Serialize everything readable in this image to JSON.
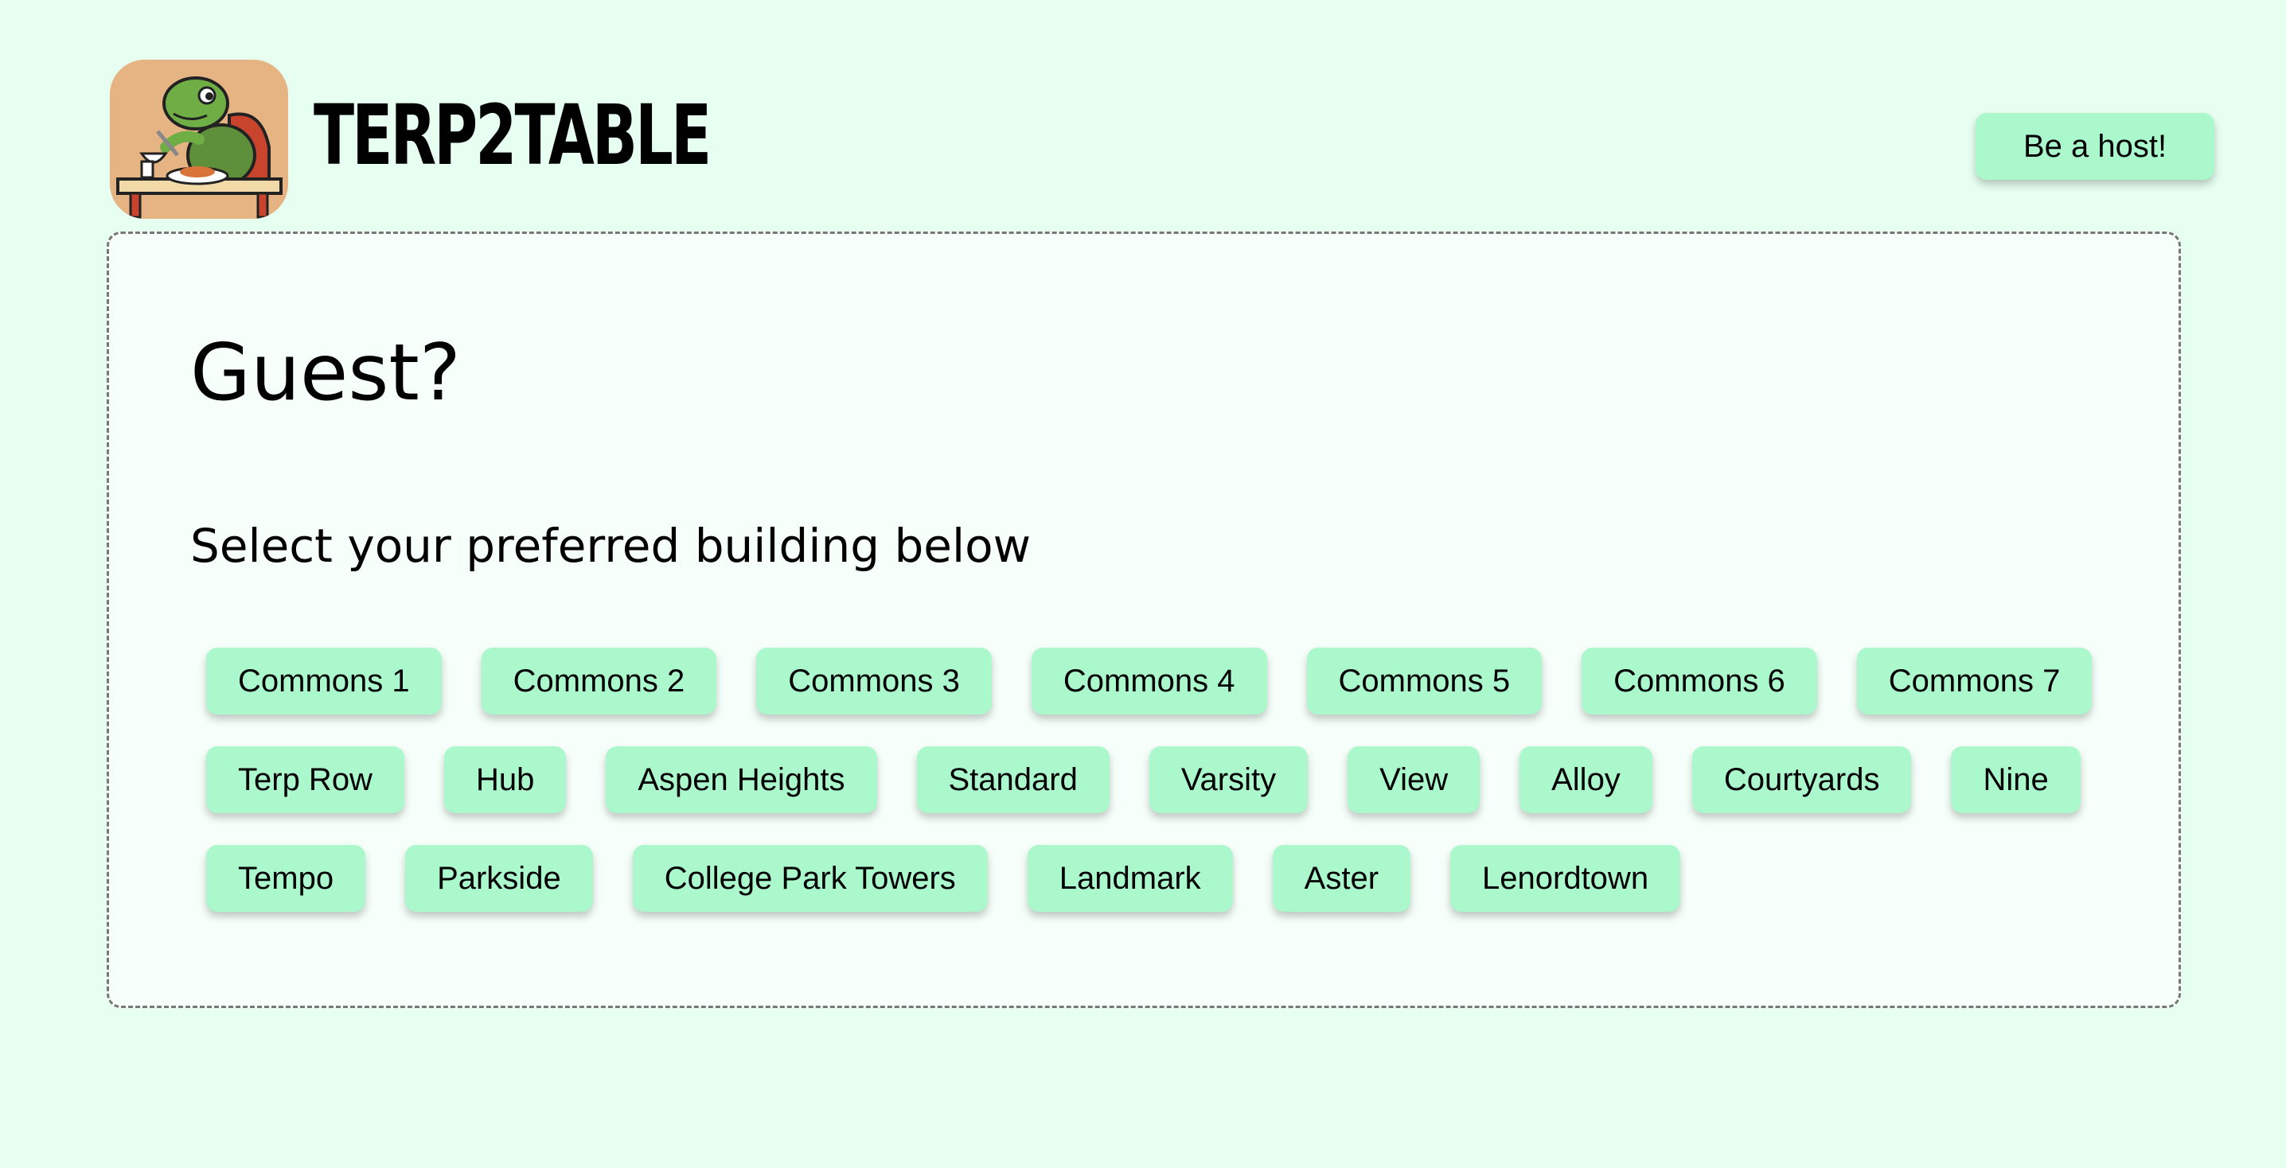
{
  "header": {
    "brand": "TERP2TABLE",
    "host_button_label": "Be a host!",
    "logo_icon": "turtle-dining-logo-icon"
  },
  "panel": {
    "title": "Guest?",
    "subtitle": "Select your preferred building below",
    "building_rows": [
      [
        "Commons 1",
        "Commons 2",
        "Commons 3",
        "Commons 4",
        "Commons 5",
        "Commons 6",
        "Commons 7"
      ],
      [
        "Terp Row",
        "Hub",
        "Aspen Heights",
        "Standard",
        "Varsity",
        "View",
        "Alloy",
        "Courtyards",
        "Nine"
      ],
      [
        "Tempo",
        "Parkside",
        "College Park Towers",
        "Landmark",
        "Aster",
        "Lenordtown"
      ]
    ]
  },
  "colors": {
    "page_background": "#e6fff0",
    "panel_background": "#f6fff9",
    "button_background": "#aaf8cc"
  }
}
